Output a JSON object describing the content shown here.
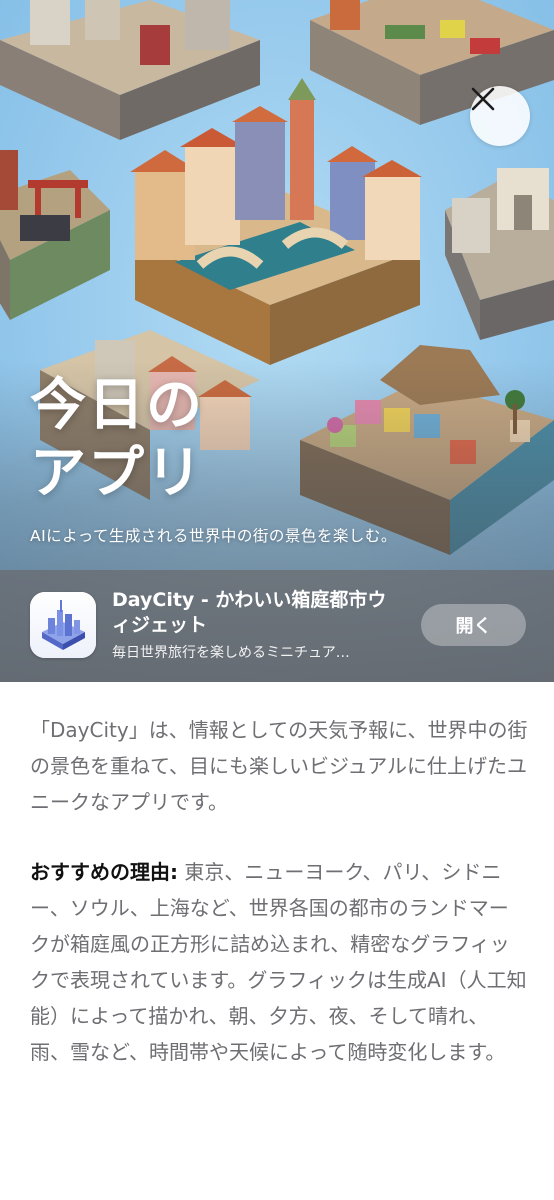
{
  "hero": {
    "title_line1": "今日の",
    "title_line2": "アプリ",
    "subtitle": "AIによって生成される世界中の街の景色を楽しむ。",
    "close_icon": "close-icon"
  },
  "app": {
    "name": "DayCity - かわいい箱庭都市ウィジェット",
    "description": "毎日世界旅行を楽しめるミニチュア…",
    "open_label": "開く",
    "icon": "city-buildings-icon"
  },
  "article": {
    "intro": "「DayCity」は、情報としての天気予報に、世界中の街の景色を重ねて、目にも楽しいビジュアルに仕上げたユニークなアプリです。",
    "reason_label": "おすすめの理由:",
    "reason_text": " 東京、ニューヨーク、パリ、シドニー、ソウル、上海など、世界各国の都市のランドマークが箱庭風の正方形に詰め込まれ、精密なグラフィックで表現されています。グラフィックは生成AI（人工知能）によって描かれ、朝、夕方、夜、そして晴れ、雨、雪など、時間帯や天候によって随時変化します。"
  },
  "colors": {
    "sky": "#9ccdee",
    "body_text": "#6e6e73",
    "bold_text": "#111111"
  }
}
